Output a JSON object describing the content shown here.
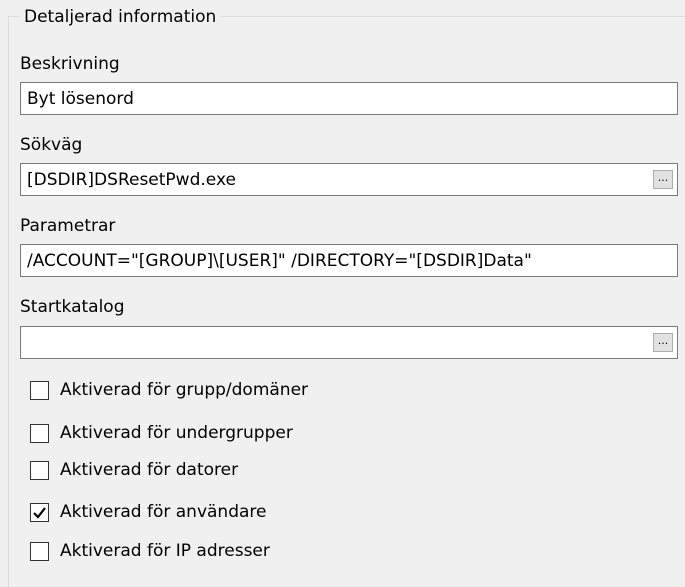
{
  "group": {
    "title": "Detaljerad information"
  },
  "fields": {
    "description": {
      "label": "Beskrivning",
      "value": "Byt lösenord"
    },
    "path": {
      "label": "Sökväg",
      "value": "[DSDIR]DSResetPwd.exe",
      "browse_label": "..."
    },
    "parameters": {
      "label": "Parametrar",
      "value": "/ACCOUNT=\"[GROUP]\\[USER]\" /DIRECTORY=\"[DSDIR]Data\""
    },
    "start_dir": {
      "label": "Startkatalog",
      "value": "",
      "browse_label": "..."
    }
  },
  "checkboxes": [
    {
      "label": "Aktiverad för grupp/domäner",
      "checked": false
    },
    {
      "label": "Aktiverad för undergrupper",
      "checked": false
    },
    {
      "label": "Aktiverad för datorer",
      "checked": false
    },
    {
      "label": "Aktiverad för användare",
      "checked": true
    },
    {
      "label": "Aktiverad för IP adresser",
      "checked": false
    }
  ]
}
